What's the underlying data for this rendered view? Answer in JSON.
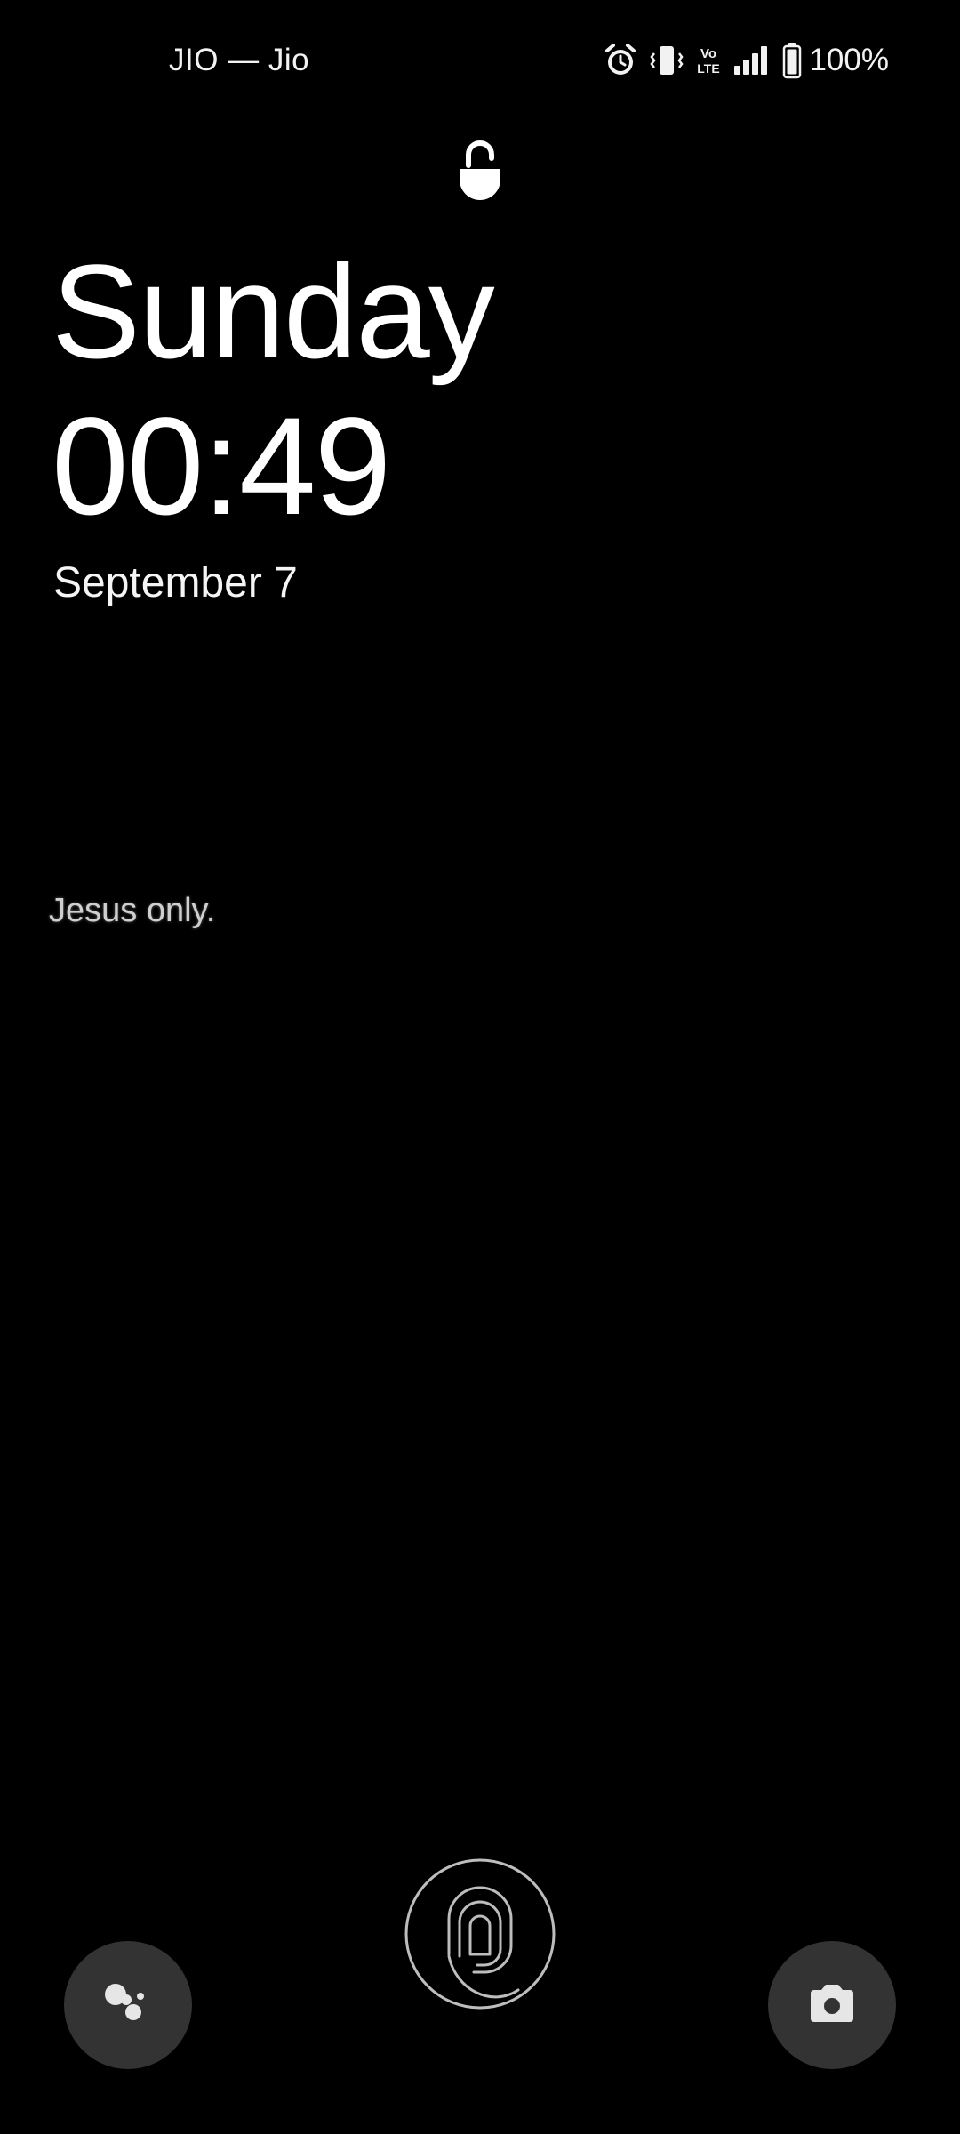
{
  "status_bar": {
    "carrier": "JIO — Jio",
    "network_label": "Vo LTE",
    "battery_percent": "100%",
    "icons": [
      "alarm-icon",
      "vibrate-icon",
      "volte-icon",
      "signal-icon",
      "battery-icon"
    ]
  },
  "lock_screen": {
    "lock_icon": "lock-icon",
    "day": "Sunday",
    "time": "00:49",
    "date": "September 7",
    "owner_message": "Jesus only."
  },
  "bottom": {
    "fingerprint_icon": "fingerprint-icon",
    "left_shortcut_icon": "assistant-icon",
    "right_shortcut_icon": "camera-icon"
  },
  "colors": {
    "background": "#000000",
    "text": "#ffffff",
    "button_bg": "#333333",
    "fingerprint_stroke": "#bdbdbd"
  }
}
